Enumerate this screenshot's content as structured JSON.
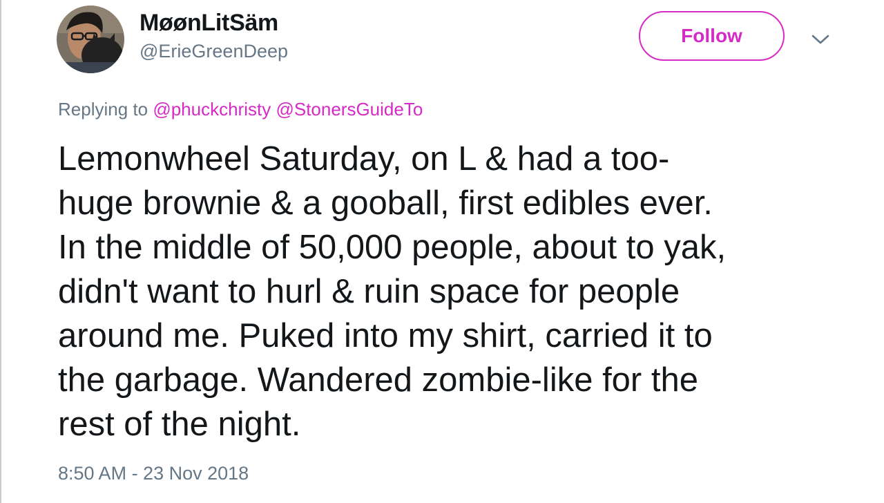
{
  "author": {
    "display_name": "MøønLitSäm",
    "handle": "@ErieGreenDeep"
  },
  "follow_button": {
    "label": "Follow"
  },
  "accent_color": "#d62ac6",
  "secondary_text_color": "#657786",
  "reply": {
    "prefix": "Replying to",
    "mentions": [
      "@phuckchristy",
      "@StonersGuideTo"
    ]
  },
  "tweet": {
    "lines": [
      "Lemonwheel Saturday, on L & had a too-",
      "huge brownie & a gooball, first edibles ever.",
      "In the middle of 50,000 people, about to yak,",
      "didn't want to hurl & ruin space for people",
      "around me. Puked into my shirt, carried it to",
      "the garbage. Wandered zombie-like for the",
      "rest of the night."
    ]
  },
  "timestamp": "8:50 AM - 23 Nov 2018",
  "icons": {
    "menu": "chevron-down-icon",
    "avatar": "user-avatar"
  }
}
